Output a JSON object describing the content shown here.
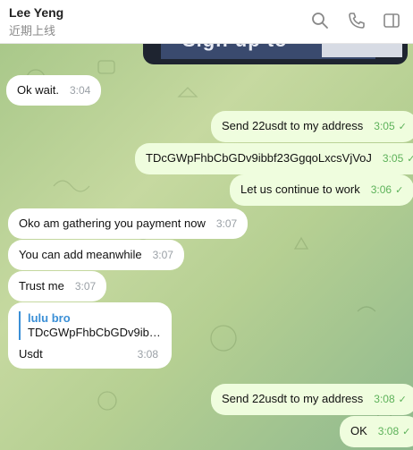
{
  "header": {
    "contact_name": "Lee Yeng",
    "contact_status": "近期上线"
  },
  "media_preview": {
    "text": "Sign up to"
  },
  "messages": [
    {
      "dir": "in",
      "text": "Ok wait.",
      "time": "3:04"
    },
    {
      "dir": "out",
      "text": "Send 22usdt to my address",
      "time": "3:05"
    },
    {
      "dir": "out",
      "text": "TDcGWpFhbCbGDv9ibbf23GgqoLxcsVjVoJ",
      "time": "3:05"
    },
    {
      "dir": "out",
      "text": "Let us continue to work",
      "time": "3:06"
    },
    {
      "dir": "in",
      "text": "Oko am gathering you payment now",
      "time": "3:07"
    },
    {
      "dir": "in",
      "text": "You can add meanwhile",
      "time": "3:07"
    },
    {
      "dir": "in",
      "text": "Trust me",
      "time": "3:07"
    },
    {
      "dir": "in",
      "reply_name": "lulu bro",
      "reply_text": "TDcGWpFhbCbGDv9ib…",
      "text": "Usdt",
      "time": "3:08"
    },
    {
      "dir": "out",
      "text": "Send 22usdt to my address",
      "time": "3:08"
    },
    {
      "dir": "out",
      "text": "OK",
      "time": "3:08"
    }
  ],
  "colors": {
    "incoming_bubble": "#ffffff",
    "outgoing_bubble": "#effdde",
    "outgoing_time": "#5db25a",
    "reply_accent": "#3a8fd6"
  },
  "icons": [
    "search-icon",
    "phone-icon",
    "sidebar-toggle-icon",
    "double-check-icon"
  ]
}
